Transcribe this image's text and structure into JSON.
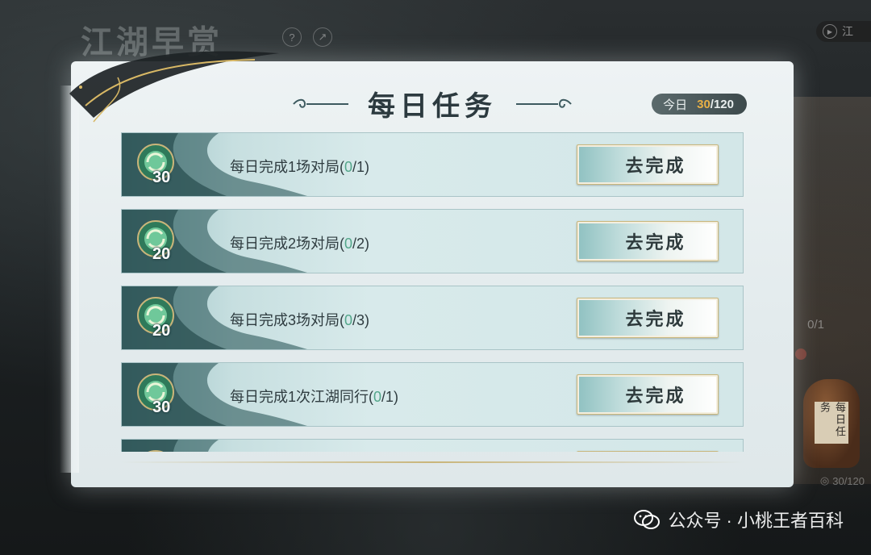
{
  "background": {
    "title": "江湖早赏",
    "help_icon": "question-icon",
    "share_icon": "share-icon",
    "top_right_label": "江",
    "side_text": "0/1",
    "jar_label": "每日任务",
    "side_progress": "30/120"
  },
  "panel": {
    "title": "每日任务",
    "today_label": "今日",
    "today_current": "30",
    "today_max": "/120"
  },
  "tasks": [
    {
      "reward": "30",
      "text": "每日完成1场对局(",
      "progress": "0",
      "total": "/1)",
      "button": "去完成"
    },
    {
      "reward": "20",
      "text": "每日完成2场对局(",
      "progress": "0",
      "total": "/2)",
      "button": "去完成"
    },
    {
      "reward": "20",
      "text": "每日完成3场对局(",
      "progress": "0",
      "total": "/3)",
      "button": "去完成"
    },
    {
      "reward": "30",
      "text": "每日完成1次江湖同行(",
      "progress": "0",
      "total": "/1)",
      "button": "去完成"
    },
    {
      "reward": "",
      "text": "",
      "progress": "",
      "total": "",
      "button": ""
    }
  ],
  "watermark": {
    "text": "公众号 · 小桃王者百科"
  },
  "colors": {
    "progress_green": "#53a68a",
    "today_gold": "#e7b046",
    "panel_bg": "#eef3f4"
  }
}
